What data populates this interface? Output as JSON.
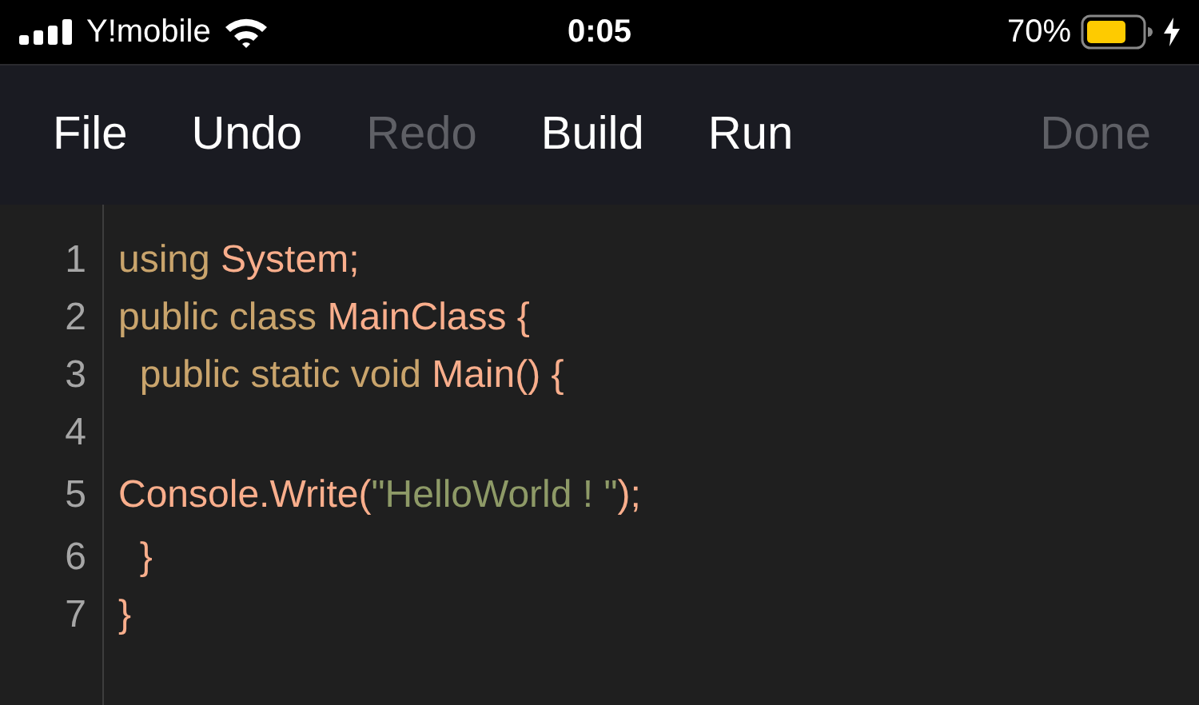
{
  "status_bar": {
    "carrier": "Y!mobile",
    "time": "0:05",
    "battery_percent": "70%"
  },
  "toolbar": {
    "buttons": [
      {
        "label": "File",
        "disabled": false
      },
      {
        "label": "Undo",
        "disabled": false
      },
      {
        "label": "Redo",
        "disabled": true
      },
      {
        "label": "Build",
        "disabled": false
      },
      {
        "label": "Run",
        "disabled": false
      }
    ],
    "done": {
      "label": "Done",
      "disabled": true
    }
  },
  "editor": {
    "lines": [
      {
        "number": "1",
        "tokens": [
          {
            "kind": "keyword",
            "text": "using "
          },
          {
            "kind": "name",
            "text": "System;"
          }
        ]
      },
      {
        "number": "2",
        "tokens": [
          {
            "kind": "keyword",
            "text": "public class "
          },
          {
            "kind": "name",
            "text": "MainClass {"
          }
        ]
      },
      {
        "number": "3",
        "tokens": [
          {
            "kind": "keyword",
            "text": "  public static void "
          },
          {
            "kind": "name",
            "text": "Main() {"
          }
        ]
      },
      {
        "number": "4"
      },
      {
        "number": "5",
        "tokens": [
          {
            "kind": "name",
            "text": "Console.Write("
          },
          {
            "kind": "string",
            "text": "\"HelloWorld ! \""
          },
          {
            "kind": "name",
            "text": ");"
          }
        ]
      },
      {
        "number": "6",
        "tokens": [
          {
            "kind": "name",
            "text": "  }"
          }
        ]
      },
      {
        "number": "7",
        "tokens": [
          {
            "kind": "name",
            "text": "}"
          }
        ]
      }
    ]
  }
}
